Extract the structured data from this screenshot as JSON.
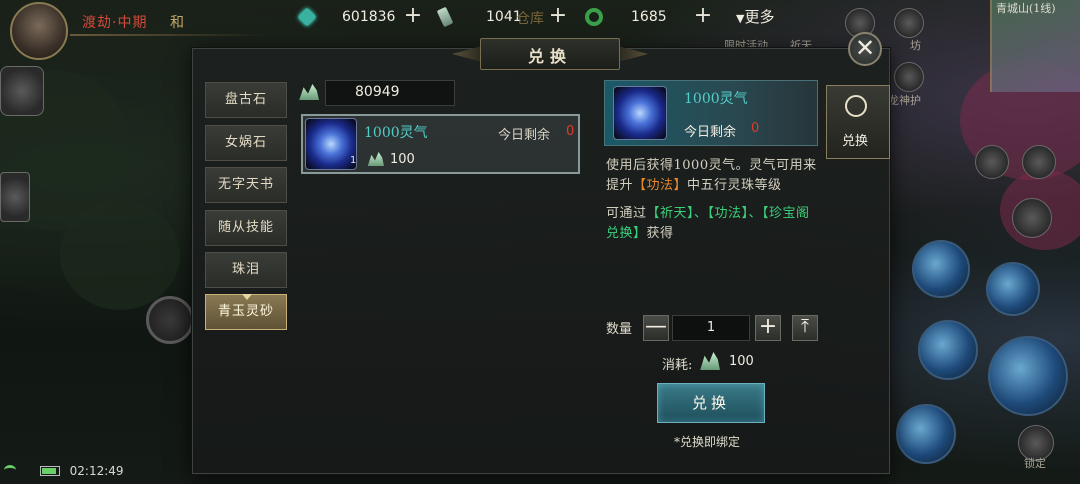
{
  "hud": {
    "realm": "渡劫·中期",
    "realm_extra": "和",
    "resources": [
      {
        "icon": "gem-icon",
        "value": "601836"
      },
      {
        "icon": "scroll-icon",
        "value": "1041"
      },
      {
        "icon": "jade-icon",
        "value": "1685"
      }
    ],
    "cangku": "仓库",
    "more_label": "更多",
    "ghost_labels": [
      "限时活动",
      "祈天",
      "坊",
      "龙神护"
    ],
    "minimap_title": "青城山(1线)",
    "lock_label": "锁定",
    "time": "02:12:49"
  },
  "panel": {
    "title": "兑换",
    "close_label": "✕",
    "categories": [
      "盘古石",
      "女娲石",
      "无字天书",
      "随从技能",
      "珠泪",
      "青玉灵砂"
    ],
    "active_category": 5,
    "currency_value": "80949",
    "item": {
      "name": "1000灵气",
      "count": "1",
      "remain_label": "今日剩余",
      "remain_value": "0",
      "cost": "100"
    },
    "detail": {
      "name": "1000灵气",
      "remain_label": "今日剩余",
      "remain_value": "0",
      "desc1_a": "使用后获得1000灵气。灵气可用来提升",
      "desc1_hl": "【功法】",
      "desc1_b": "中五行灵珠等级",
      "desc2_a": "可通过",
      "desc2_hl": "【祈天】、【功法】、【珍宝阁兑换】",
      "desc2_b": "获得"
    },
    "qty_label": "数量",
    "qty_value": "1",
    "minus_label": "—",
    "plus_label": "+",
    "max_label": "⤒",
    "cost_label": "消耗:",
    "cost_value": "100",
    "exchange_label": "兑换",
    "bind_note": "*兑换即绑定",
    "side_tab_label": "兑换"
  }
}
